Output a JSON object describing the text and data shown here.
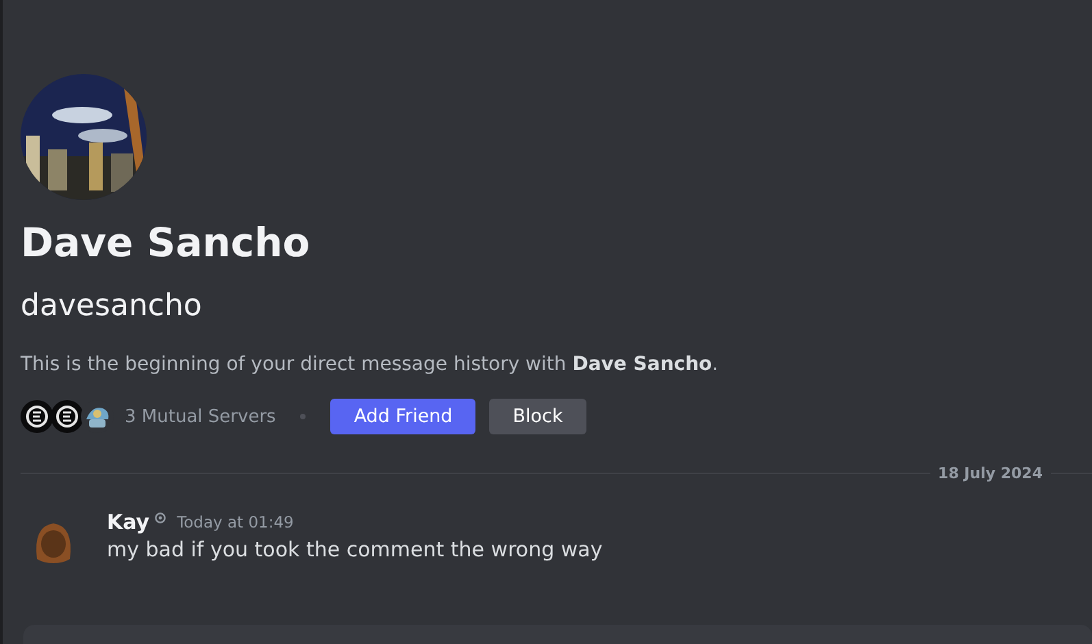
{
  "profile": {
    "display_name": "Dave Sancho",
    "username": "davesancho",
    "intro": "This is the beginning of your direct message history with **Dave Sancho**.",
    "mutual_servers": {
      "count_label": "3 Mutual Servers",
      "servers": [
        {
          "kind": "emblem"
        },
        {
          "kind": "emblem"
        },
        {
          "kind": "picture"
        }
      ]
    },
    "buttons": [
      {
        "label": "Add Friend",
        "kind": "primary"
      },
      {
        "label": "Block",
        "kind": "secondary"
      }
    ]
  },
  "date_divider": "18 July 2024",
  "messages": [
    {
      "author": "Kay",
      "timestamp": "Today at 01:49",
      "text": "my bad if you took the comment the wrong way"
    }
  ]
}
